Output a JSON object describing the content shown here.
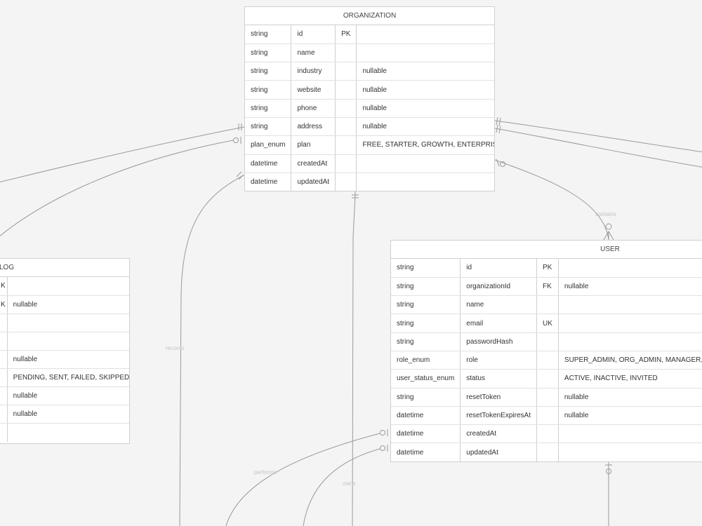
{
  "organization": {
    "title": "ORGANIZATION",
    "rows": [
      [
        "string",
        "id",
        "PK",
        ""
      ],
      [
        "string",
        "name",
        "",
        ""
      ],
      [
        "string",
        "industry",
        "",
        "nullable"
      ],
      [
        "string",
        "website",
        "",
        "nullable"
      ],
      [
        "string",
        "phone",
        "",
        "nullable"
      ],
      [
        "string",
        "address",
        "",
        "nullable"
      ],
      [
        "plan_enum",
        "plan",
        "",
        "FREE, STARTER, GROWTH, ENTERPRISE"
      ],
      [
        "datetime",
        "createdAt",
        "",
        ""
      ],
      [
        "datetime",
        "updatedAt",
        "",
        ""
      ]
    ]
  },
  "user": {
    "title": "USER",
    "rows": [
      [
        "string",
        "id",
        "PK",
        ""
      ],
      [
        "string",
        "organizationId",
        "FK",
        "nullable"
      ],
      [
        "string",
        "name",
        "",
        ""
      ],
      [
        "string",
        "email",
        "UK",
        ""
      ],
      [
        "string",
        "passwordHash",
        "",
        ""
      ],
      [
        "role_enum",
        "role",
        "",
        "SUPER_ADMIN, ORG_ADMIN, MANAGER, S"
      ],
      [
        "user_status_enum",
        "status",
        "",
        "ACTIVE, INACTIVE, INVITED"
      ],
      [
        "string",
        "resetToken",
        "",
        "nullable"
      ],
      [
        "datetime",
        "resetTokenExpiresAt",
        "",
        "nullable"
      ],
      [
        "datetime",
        "createdAt",
        "",
        ""
      ],
      [
        "datetime",
        "updatedAt",
        "",
        ""
      ]
    ]
  },
  "log": {
    "title": "LOG",
    "rows": [
      [
        "K",
        ""
      ],
      [
        "K",
        "nullable"
      ],
      [
        "",
        ""
      ],
      [
        "",
        ""
      ],
      [
        "",
        "nullable"
      ],
      [
        "",
        "PENDING, SENT, FAILED, SKIPPED"
      ],
      [
        "",
        "nullable"
      ],
      [
        "",
        "nullable"
      ],
      [
        "",
        ""
      ]
    ]
  },
  "relationships": [
    {
      "label": "contains"
    },
    {
      "label": "records"
    },
    {
      "label": "performs"
    },
    {
      "label": "owns"
    }
  ],
  "colors": {
    "background": "#f4f4f4",
    "line": "#9a9a9a",
    "border": "#cfcfcf",
    "label": "#c4c4c4"
  }
}
